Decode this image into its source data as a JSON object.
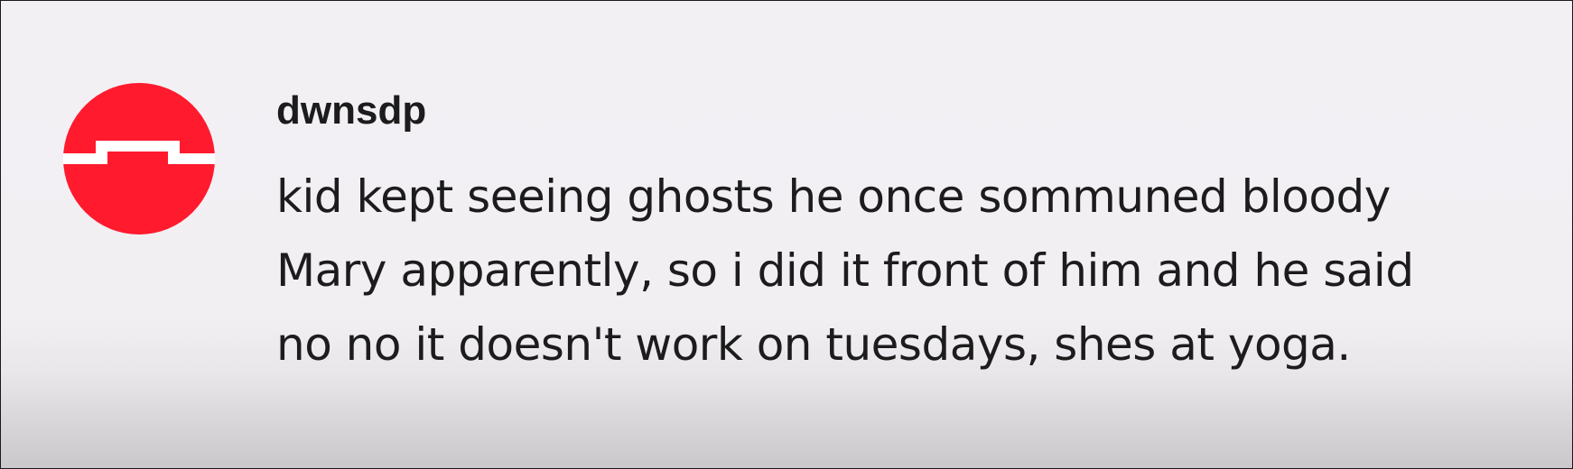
{
  "comment": {
    "author": "dwnsdp",
    "text_lines": [
      "kid kept seeing ghosts he once sommuned bloody",
      "Mary apparently, so i did it front of him and he said",
      "no no it doesn't work on tuesdays, shes at yoga."
    ],
    "avatar": {
      "icon": "red-circle-with-white-step-line-icon",
      "color": "#ff1a2e",
      "line_color": "#ffffff"
    }
  },
  "colors": {
    "background": "#f3f0f4",
    "text": "#1c1c1c"
  }
}
